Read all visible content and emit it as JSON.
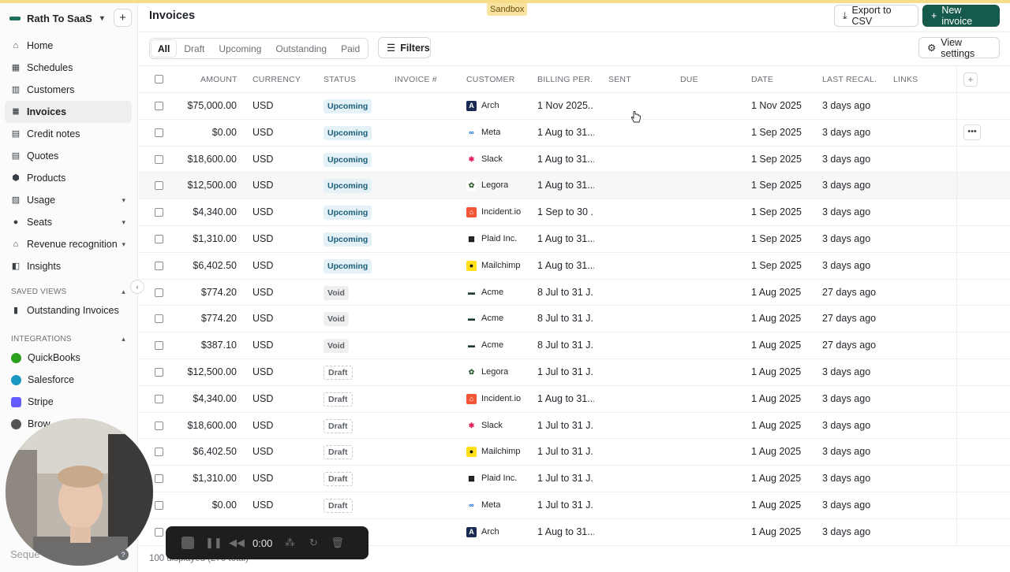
{
  "environment_badge": "Sandbox",
  "sidebar": {
    "org_name": "Rath To SaaS",
    "nav": [
      {
        "label": "Home",
        "icon": "home-icon"
      },
      {
        "label": "Schedules",
        "icon": "calendar-icon"
      },
      {
        "label": "Customers",
        "icon": "building-icon"
      },
      {
        "label": "Invoices",
        "icon": "stack-icon",
        "active": true
      },
      {
        "label": "Credit notes",
        "icon": "note-icon"
      },
      {
        "label": "Quotes",
        "icon": "quote-icon"
      },
      {
        "label": "Products",
        "icon": "cube-icon"
      },
      {
        "label": "Usage",
        "icon": "chart-icon",
        "expandable": true
      },
      {
        "label": "Seats",
        "icon": "users-icon",
        "expandable": true
      },
      {
        "label": "Revenue recognition",
        "icon": "bank-icon",
        "expandable": true
      },
      {
        "label": "Insights",
        "icon": "insights-icon"
      }
    ],
    "saved_views_title": "SAVED VIEWS",
    "saved_views": [
      {
        "label": "Outstanding Invoices",
        "icon": "bookmark-icon"
      }
    ],
    "integrations_title": "INTEGRATIONS",
    "integrations": [
      {
        "label": "QuickBooks",
        "icon": "quickbooks-icon",
        "color": "#2ca01c"
      },
      {
        "label": "Salesforce",
        "icon": "salesforce-icon",
        "color": "#1798c1"
      },
      {
        "label": "Stripe",
        "icon": "stripe-icon",
        "color": "#635bff"
      },
      {
        "label": "Brow",
        "icon": "browser-icon",
        "color": "#555555"
      }
    ],
    "footer_text": "Seque"
  },
  "header": {
    "title": "Invoices",
    "export_label": "Export to CSV",
    "new_label": "New invoice"
  },
  "tabs": [
    "All",
    "Draft",
    "Upcoming",
    "Outstanding",
    "Paid"
  ],
  "filters_label": "Filters",
  "view_settings_label": "View settings",
  "columns": [
    "AMOUNT",
    "CURRENCY",
    "STATUS",
    "INVOICE #",
    "CUSTOMER",
    "BILLING PER...",
    "SENT",
    "DUE",
    "DATE",
    "LAST RECAL...",
    "LINKS"
  ],
  "rows": [
    {
      "amount": "$75,000.00",
      "currency": "USD",
      "status": "Upcoming",
      "customer": "Arch",
      "logo": "arch",
      "billing": "1 Nov 2025...",
      "date": "1 Nov 2025",
      "recalc": "3 days ago"
    },
    {
      "amount": "$0.00",
      "currency": "USD",
      "status": "Upcoming",
      "customer": "Meta",
      "logo": "meta",
      "billing": "1 Aug to 31...",
      "date": "1 Sep 2025",
      "recalc": "3 days ago"
    },
    {
      "amount": "$18,600.00",
      "currency": "USD",
      "status": "Upcoming",
      "customer": "Slack",
      "logo": "slack",
      "billing": "1 Aug to 31...",
      "date": "1 Sep 2025",
      "recalc": "3 days ago"
    },
    {
      "amount": "$12,500.00",
      "currency": "USD",
      "status": "Upcoming",
      "customer": "Legora",
      "logo": "legora",
      "billing": "1 Aug to 31...",
      "date": "1 Sep 2025",
      "recalc": "3 days ago"
    },
    {
      "amount": "$4,340.00",
      "currency": "USD",
      "status": "Upcoming",
      "customer": "Incident.io",
      "logo": "incident",
      "billing": "1 Sep to 30 ...",
      "date": "1 Sep 2025",
      "recalc": "3 days ago"
    },
    {
      "amount": "$1,310.00",
      "currency": "USD",
      "status": "Upcoming",
      "customer": "Plaid Inc.",
      "logo": "plaid",
      "billing": "1 Aug to 31...",
      "date": "1 Sep 2025",
      "recalc": "3 days ago"
    },
    {
      "amount": "$6,402.50",
      "currency": "USD",
      "status": "Upcoming",
      "customer": "Mailchimp",
      "logo": "mailchimp",
      "billing": "1 Aug to 31...",
      "date": "1 Sep 2025",
      "recalc": "3 days ago"
    },
    {
      "amount": "$774.20",
      "currency": "USD",
      "status": "Void",
      "customer": "Acme",
      "logo": "acme",
      "billing": "8 Jul to 31 J...",
      "date": "1 Aug 2025",
      "recalc": "27 days ago"
    },
    {
      "amount": "$774.20",
      "currency": "USD",
      "status": "Void",
      "customer": "Acme",
      "logo": "acme",
      "billing": "8 Jul to 31 J...",
      "date": "1 Aug 2025",
      "recalc": "27 days ago"
    },
    {
      "amount": "$387.10",
      "currency": "USD",
      "status": "Void",
      "customer": "Acme",
      "logo": "acme",
      "billing": "8 Jul to 31 J...",
      "date": "1 Aug 2025",
      "recalc": "27 days ago"
    },
    {
      "amount": "$12,500.00",
      "currency": "USD",
      "status": "Draft",
      "customer": "Legora",
      "logo": "legora",
      "billing": "1 Jul to 31 J...",
      "date": "1 Aug 2025",
      "recalc": "3 days ago"
    },
    {
      "amount": "$4,340.00",
      "currency": "USD",
      "status": "Draft",
      "customer": "Incident.io",
      "logo": "incident",
      "billing": "1 Aug to 31...",
      "date": "1 Aug 2025",
      "recalc": "3 days ago"
    },
    {
      "amount": "$18,600.00",
      "currency": "USD",
      "status": "Draft",
      "customer": "Slack",
      "logo": "slack",
      "billing": "1 Jul to 31 J...",
      "date": "1 Aug 2025",
      "recalc": "3 days ago"
    },
    {
      "amount": "$6,402.50",
      "currency": "USD",
      "status": "Draft",
      "customer": "Mailchimp",
      "logo": "mailchimp",
      "billing": "1 Jul to 31 J...",
      "date": "1 Aug 2025",
      "recalc": "3 days ago"
    },
    {
      "amount": "$1,310.00",
      "currency": "USD",
      "status": "Draft",
      "customer": "Plaid Inc.",
      "logo": "plaid",
      "billing": "1 Jul to 31 J...",
      "date": "1 Aug 2025",
      "recalc": "3 days ago"
    },
    {
      "amount": "$0.00",
      "currency": "USD",
      "status": "Draft",
      "customer": "Meta",
      "logo": "meta",
      "billing": "1 Jul to 31 J...",
      "date": "1 Aug 2025",
      "recalc": "3 days ago"
    },
    {
      "amount": "",
      "currency": "",
      "status": "",
      "customer": "Arch",
      "logo": "arch",
      "billing": "1 Aug to 31...",
      "date": "1 Aug 2025",
      "recalc": "3 days ago"
    }
  ],
  "footer_count": "100 displayed (270 total)",
  "recorder": {
    "time": "0:00"
  },
  "colors": {
    "primary": "#155a4a",
    "upcoming_bg": "#e4f1f7",
    "upcoming_text": "#1b5f7a",
    "sandbox": "#f9e3a0"
  }
}
